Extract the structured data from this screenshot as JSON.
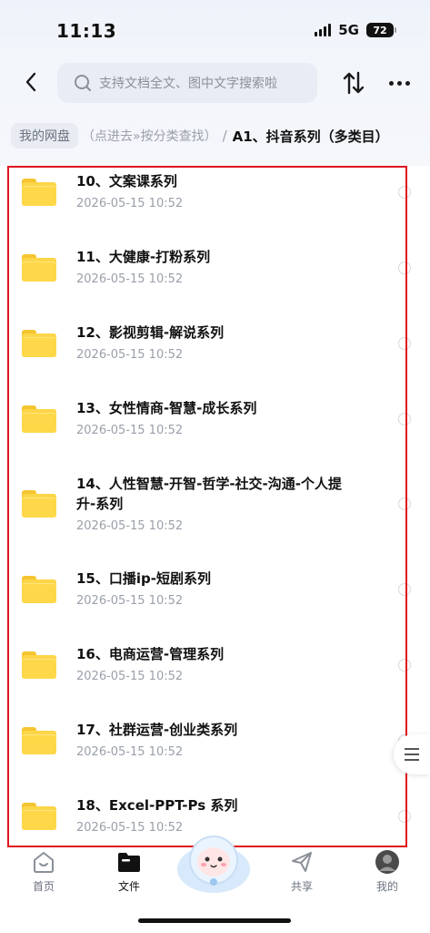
{
  "status_bar": {
    "time": "11:13",
    "network": "5G",
    "battery": "72"
  },
  "header": {
    "search_placeholder": "支持文档全文、图中文字搜索啦",
    "back_icon": "chevron-left-icon",
    "sort_icon": "sort-arrows-icon",
    "more_icon": "more-horizontal-icon"
  },
  "breadcrumb": {
    "root": "我的网盘",
    "middle": "（点进去»按分类查找）",
    "separator": "/",
    "current": "A1、抖音系列（多类目）"
  },
  "files": [
    {
      "name": "10、文案课系列",
      "date": "2026-05-15 10:52"
    },
    {
      "name": "11、大健康-打粉系列",
      "date": "2026-05-15 10:52"
    },
    {
      "name": "12、影视剪辑-解说系列",
      "date": "2026-05-15 10:52"
    },
    {
      "name": "13、女性情商-智慧-成长系列",
      "date": "2026-05-15 10:52"
    },
    {
      "name": "14、人性智慧-开智-哲学-社交-沟通-个人提升-系列",
      "date": "2026-05-15 10:52"
    },
    {
      "name": "15、口播ip-短剧系列",
      "date": "2026-05-15 10:52"
    },
    {
      "name": "16、电商运营-管理系列",
      "date": "2026-05-15 10:52"
    },
    {
      "name": "17、社群运营-创业类系列",
      "date": "2026-05-15 10:52"
    },
    {
      "name": "18、Excel-PPT-Ps 系列",
      "date": "2026-05-15 10:52"
    }
  ],
  "tabbar": {
    "home": "首页",
    "files": "文件",
    "share": "共享",
    "mine": "我的"
  },
  "colors": {
    "highlight": "#e0141e",
    "folder": "#fdd548"
  }
}
